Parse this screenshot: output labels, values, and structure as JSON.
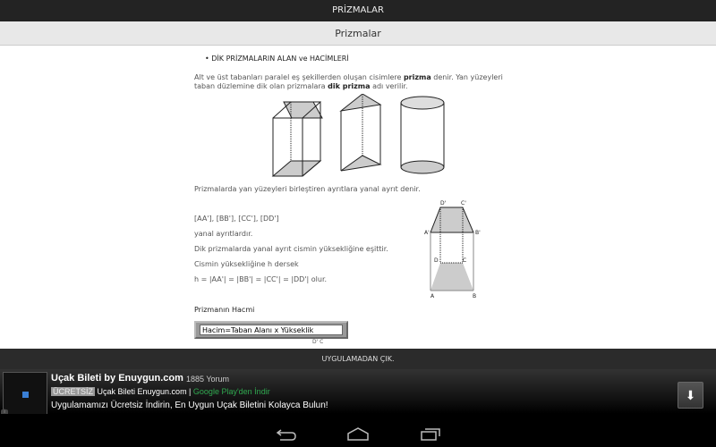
{
  "app_title": "PRİZMALAR",
  "page_title": "Prizmalar",
  "content": {
    "heading": "• DİK PRİZMALARIN ALAN ve HACİMLERİ",
    "para1_a": "Alt ve üst tabanları paralel eş şekillerden oluşan cisimlere ",
    "para1_b": "prizma",
    "para1_c": " denir. Yan yüzeyleri",
    "para2_a": "taban düzlemine dik olan prizmalara ",
    "para2_b": "dik prizma",
    "para2_c": " adı verilir.",
    "para3": "Prizmalarda yan yüzeyleri birleştiren ayrıtlara yanal ayrıt denir.",
    "edges": "[AA'], [BB'], [CC'], [DD']",
    "edges2": "yanal ayrıtlardır.",
    "line3": "Dik prizmalarda yanal ayrıt cismin yüksekliğine eşittir.",
    "line4": "Cismin yüksekliğine h dersek",
    "line5": "h = |AA'| = |BB'| = |CC'| = |DD'| olur.",
    "volume_heading": "Prizmanın Hacmi",
    "formula": "Hacim=Taban Alanı x Yükseklik",
    "cut_label": "D' C",
    "labels": {
      "D1": "D'",
      "C1": "C'",
      "A1": "A'",
      "B1": "B'",
      "D": "D",
      "C": "C",
      "A": "A",
      "B": "B"
    }
  },
  "exit_label": "UYGULAMADAN ÇIK.",
  "ad": {
    "title": "Uçak Bileti by Enuygun.com",
    "reviews": "1885 Yorum",
    "badge": "ÜCRETSİZ",
    "publisher": "Uçak Bileti Enuygun.com |",
    "store": "Google Play'den İndir",
    "description": "Uygulamamızı Ücretsiz İndirin, En Uygun Uçak Biletini Kolayca Bulun!",
    "info": "i"
  },
  "colors": {
    "store_green": "#2fa84f",
    "topbar": "#232323"
  }
}
